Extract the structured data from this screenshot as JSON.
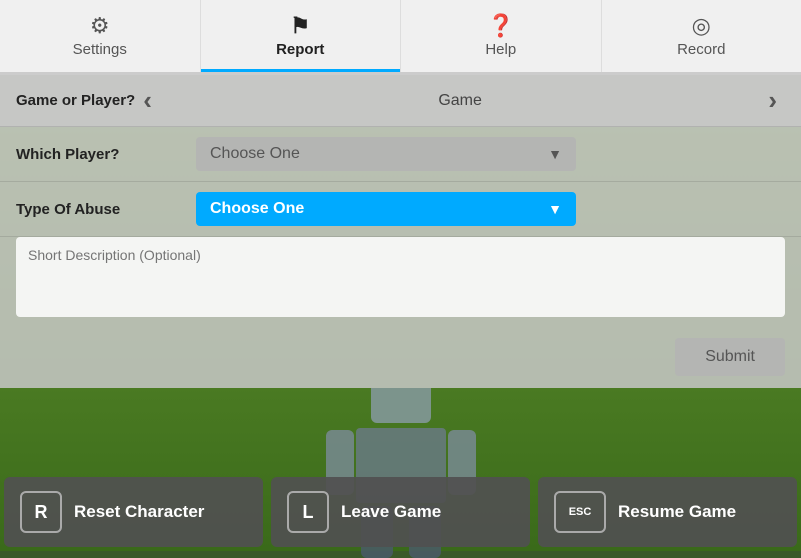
{
  "topbar": {
    "items": [
      {
        "id": "settings",
        "label": "Settings",
        "icon": "⚙",
        "active": false
      },
      {
        "id": "report",
        "label": "Report",
        "icon": "⚑",
        "active": true
      },
      {
        "id": "help",
        "label": "Help",
        "icon": "?",
        "active": false
      },
      {
        "id": "record",
        "label": "Record",
        "icon": "◎",
        "active": false
      }
    ]
  },
  "form": {
    "game_or_player_label": "Game or Player?",
    "which_player_label": "Which Player?",
    "type_of_abuse_label": "Type Of Abuse",
    "game_value": "Game",
    "choose_one_label": "Choose One",
    "choose_one_active_label": "Choose One",
    "description_placeholder": "Short Description (Optional)",
    "submit_label": "Submit"
  },
  "bottom_bar": {
    "reset": {
      "key": "R",
      "label": "Reset Character"
    },
    "leave": {
      "key": "L",
      "label": "Leave Game"
    },
    "resume": {
      "key": "ESC",
      "label": "Resume Game"
    }
  }
}
